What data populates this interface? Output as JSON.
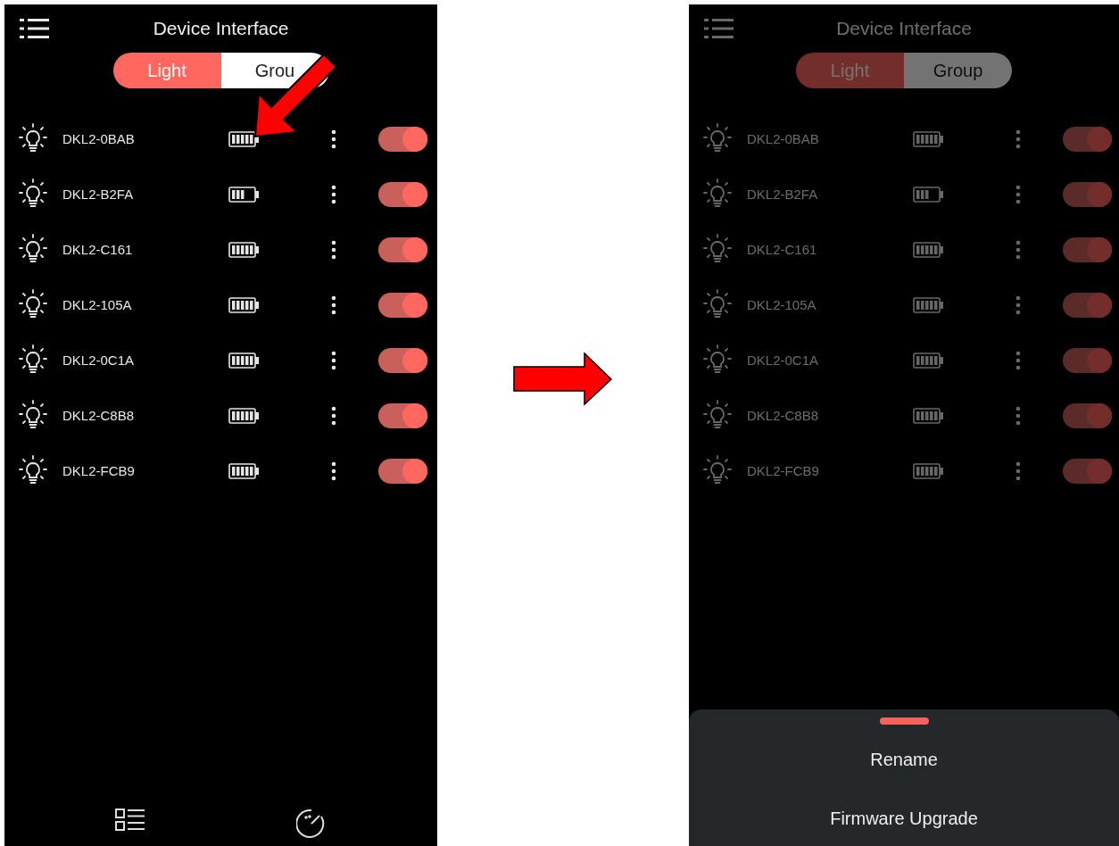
{
  "screens": [
    {
      "title": "Device Interface",
      "dimmed": false,
      "tabs": [
        {
          "label": "Light",
          "selected": true
        },
        {
          "label": "Grou",
          "selected": false
        }
      ],
      "devices": [
        {
          "name": "DKL2-0BAB",
          "battery_low": false,
          "on": true
        },
        {
          "name": "DKL2-B2FA",
          "battery_low": true,
          "on": true
        },
        {
          "name": "DKL2-C161",
          "battery_low": false,
          "on": true
        },
        {
          "name": "DKL2-105A",
          "battery_low": false,
          "on": true
        },
        {
          "name": "DKL2-0C1A",
          "battery_low": false,
          "on": true
        },
        {
          "name": "DKL2-C8B8",
          "battery_low": false,
          "on": true
        },
        {
          "name": "DKL2-FCB9",
          "battery_low": false,
          "on": true
        }
      ],
      "bottom_nav": [
        {
          "kind": "list"
        },
        {
          "kind": "timer"
        }
      ],
      "annotations": [
        {
          "kind": "pointer-arrow"
        }
      ]
    },
    {
      "title": "Device Interface",
      "dimmed": true,
      "tabs": [
        {
          "label": "Light",
          "selected": true
        },
        {
          "label": "Group",
          "selected": false
        }
      ],
      "devices": [
        {
          "name": "DKL2-0BAB",
          "battery_low": false,
          "on": true
        },
        {
          "name": "DKL2-B2FA",
          "battery_low": true,
          "on": true
        },
        {
          "name": "DKL2-C161",
          "battery_low": false,
          "on": true
        },
        {
          "name": "DKL2-105A",
          "battery_low": false,
          "on": true
        },
        {
          "name": "DKL2-0C1A",
          "battery_low": false,
          "on": true
        },
        {
          "name": "DKL2-C8B8",
          "battery_low": false,
          "on": true
        },
        {
          "name": "DKL2-FCB9",
          "battery_low": false,
          "on": true
        }
      ],
      "sheet": {
        "items": [
          "Rename",
          "Firmware Upgrade"
        ]
      }
    }
  ],
  "annotations": [
    {
      "kind": "right-arrow"
    }
  ]
}
